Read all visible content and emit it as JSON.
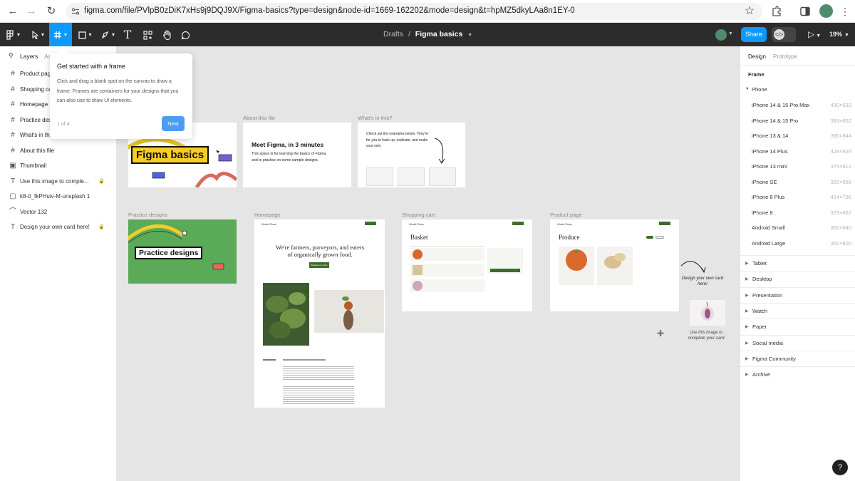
{
  "browser": {
    "url": "figma.com/file/PVlpB0zDiK7xHs9j9DQJ9X/Figma-basics?type=design&node-id=1669-162202&mode=design&t=hpMZ5dkyLAa8n1EY-0"
  },
  "toolbar": {
    "breadcrumb_root": "Drafts",
    "separator": "/",
    "file_name": "Figma basics",
    "share_label": "Share",
    "zoom_label": "19%",
    "accent_color": "#0d99ff"
  },
  "left_panel": {
    "tabs": [
      "Layers",
      "Assets"
    ],
    "layers": [
      {
        "icon": "frame",
        "label": "Product page",
        "bold": true,
        "locked": false
      },
      {
        "icon": "frame",
        "label": "Shopping cart",
        "bold": true,
        "locked": false
      },
      {
        "icon": "frame",
        "label": "Homepage",
        "bold": true,
        "locked": false
      },
      {
        "icon": "frame",
        "label": "Practice designs",
        "bold": true,
        "locked": false
      },
      {
        "icon": "frame",
        "label": "What's in this?",
        "bold": true,
        "locked": false
      },
      {
        "icon": "frame",
        "label": "About this file",
        "bold": true,
        "locked": false
      },
      {
        "icon": "thumbnail",
        "label": "Thumbnail",
        "bold": true,
        "locked": false
      },
      {
        "icon": "text",
        "label": "Use this image to comple...",
        "bold": false,
        "locked": true
      },
      {
        "icon": "image",
        "label": "k8-0_fkPHuiv-M-unsplash 1",
        "bold": false,
        "locked": false
      },
      {
        "icon": "vector",
        "label": "Vector 132",
        "bold": false,
        "locked": false
      },
      {
        "icon": "text",
        "label": "Design your own card here!",
        "bold": false,
        "locked": true
      }
    ]
  },
  "tooltip": {
    "title": "Get started with a frame",
    "body": "Click and drag a blank spot on the canvas to draw a frame. Frames are containers for your designs that you can also use to draw UI elements.",
    "step": "1 of 4",
    "next_label": "Next"
  },
  "canvas": {
    "background": "#e5e5e5",
    "frames": {
      "thumbnail": {
        "title": "Figma basics"
      },
      "about": {
        "label": "About this file",
        "heading": "Meet Figma, in 3 minutes",
        "body": "This space is for learning the basics of Figma, and to practice on some sample designs."
      },
      "whats_in": {
        "label": "What's in this?",
        "body": "Check out the examples below. They're for you to hack up, replicate, and make your own."
      },
      "practice": {
        "label": "Practice designs",
        "title": "Practice designs",
        "bg_color": "#5aaa58"
      },
      "homepage": {
        "label": "Homepage",
        "brand": "World Peas",
        "hero": "We're farmers, purveyors, and eaters of organically grown food.",
        "cta": "Browse our shop"
      },
      "cart": {
        "label": "Shopping cart",
        "brand": "World Peas",
        "heading": "Basket"
      },
      "product": {
        "label": "Product page",
        "brand": "World Peas",
        "heading": "Produce"
      }
    },
    "side_note": {
      "design_card": "Design your own card here!",
      "use_image": "Use this image to complete your card"
    }
  },
  "right_panel": {
    "tabs": [
      "Design",
      "Prototype"
    ],
    "section_title": "Frame",
    "group_title": "Phone",
    "presets": [
      {
        "name": "iPhone 14 & 15 Pro Max",
        "size": "430×932"
      },
      {
        "name": "iPhone 14 & 15 Pro",
        "size": "393×852"
      },
      {
        "name": "iPhone 13 & 14",
        "size": "390×844"
      },
      {
        "name": "iPhone 14 Plus",
        "size": "428×926"
      },
      {
        "name": "iPhone 13 mini",
        "size": "375×812"
      },
      {
        "name": "iPhone SE",
        "size": "320×568"
      },
      {
        "name": "iPhone 8 Plus",
        "size": "414×736"
      },
      {
        "name": "iPhone 8",
        "size": "375×667"
      },
      {
        "name": "Android Small",
        "size": "360×640"
      },
      {
        "name": "Android Large",
        "size": "360×800"
      }
    ],
    "categories": [
      "Tablet",
      "Desktop",
      "Presentation",
      "Watch",
      "Paper",
      "Social media",
      "Figma Community",
      "Archive"
    ]
  },
  "help": {
    "label": "?"
  }
}
